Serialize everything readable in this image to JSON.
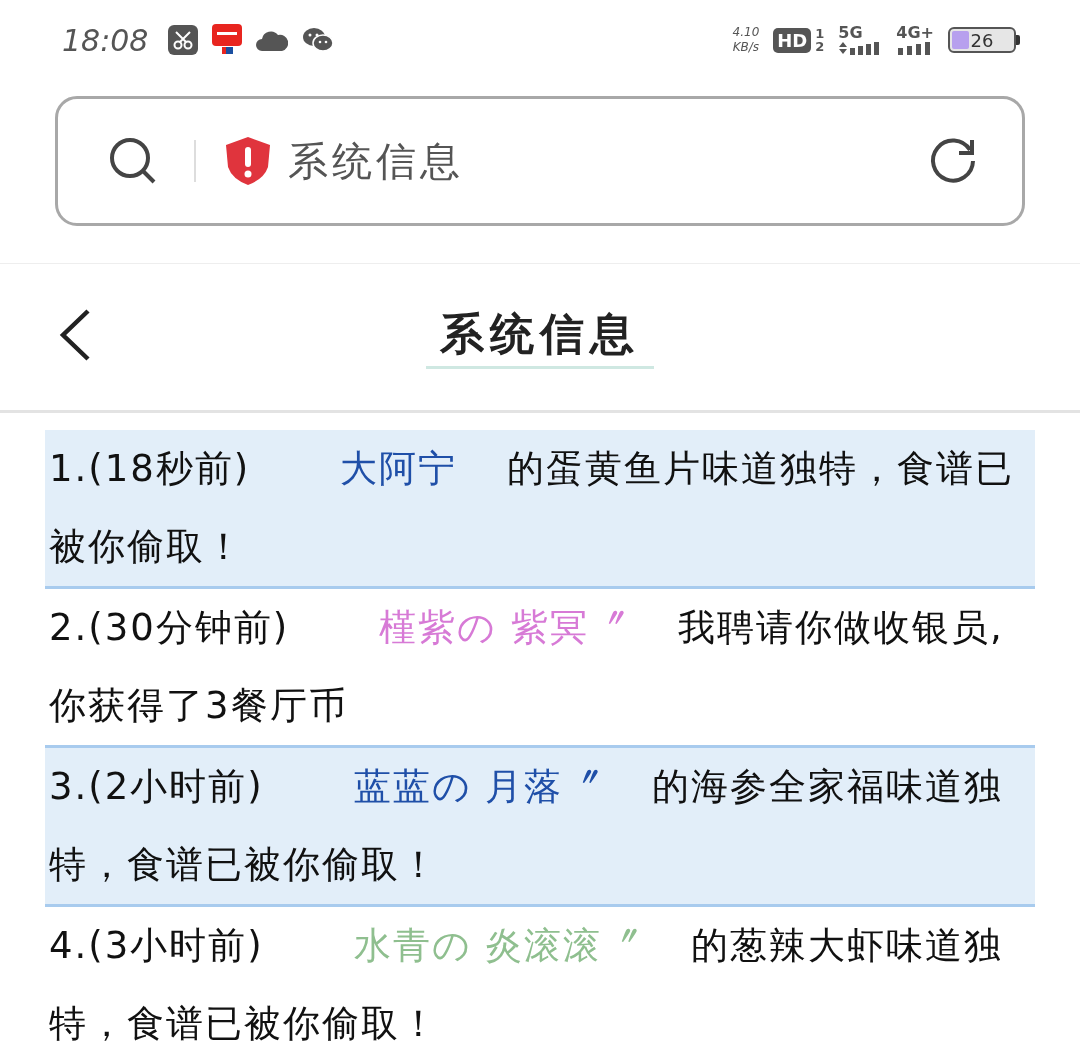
{
  "status_bar": {
    "time": "18:08",
    "speed": "4.10",
    "speed_unit": "KB/s",
    "hd": "HD",
    "sim_1": "1",
    "sim_2": "2",
    "network_1": "5G",
    "network_2": "4G+",
    "battery": "26"
  },
  "address_bar": {
    "title": "系统信息"
  },
  "header": {
    "title": "系统信息"
  },
  "messages": [
    {
      "prefix": "1.(18秒前)",
      "name": "大阿宁",
      "color": "#1f4fa8",
      "text": "的蛋黄鱼片味道独特，食谱已被你偷取！",
      "shaded": true
    },
    {
      "prefix": "2.(30分钟前)",
      "name": "槿紫の 紫冥〞",
      "color": "#d77ad6",
      "text": "我聘请你做收银员,你获得了3餐厅币",
      "shaded": false
    },
    {
      "prefix": "3.(2小时前)",
      "name": "蓝蓝の 月落〞",
      "color": "#1f4fa8",
      "text": "的海参全家福味道独特，食谱已被你偷取！",
      "shaded": true
    },
    {
      "prefix": "4.(3小时前)",
      "name": "水青の 炎滚滚〞",
      "color": "#8fbf8f",
      "text": "的葱辣大虾味道独特，食谱已被你偷取！",
      "shaded": false
    }
  ]
}
